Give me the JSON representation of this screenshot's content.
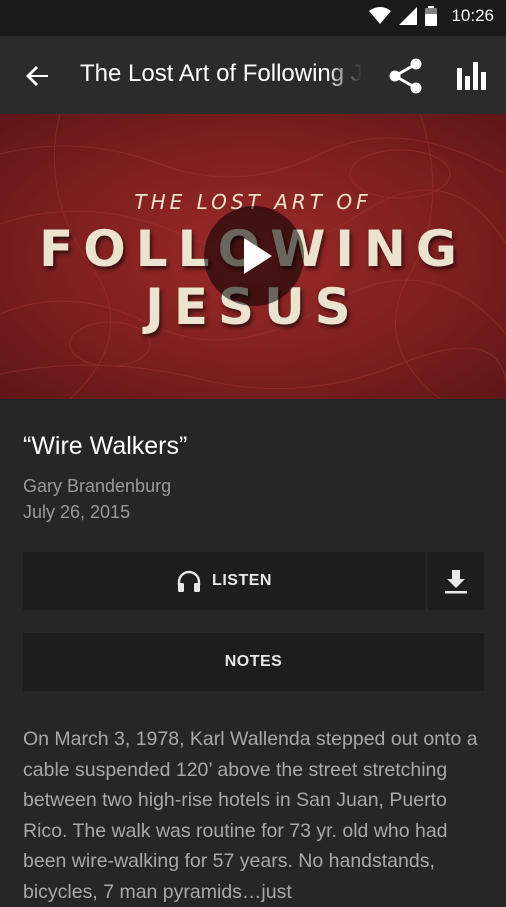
{
  "status_bar": {
    "time": "10:26",
    "icons": [
      "wifi-icon",
      "cell-signal-icon",
      "battery-icon"
    ]
  },
  "app_bar": {
    "title": "The Lost Art of Following Jesus",
    "back_icon": "arrow-left-icon",
    "share_icon": "share-icon",
    "stats_icon": "bar-chart-icon"
  },
  "hero": {
    "line1": "THE LOST ART OF",
    "line2": "FOLLOWING",
    "line3": "JESUS",
    "play_icon": "play-icon"
  },
  "sermon": {
    "title": "“Wire Walkers”",
    "speaker": "Gary Brandenburg",
    "date": "July 26, 2015"
  },
  "actions": {
    "listen_label": "LISTEN",
    "listen_icon": "headphones-icon",
    "download_icon": "download-icon",
    "notes_label": "NOTES"
  },
  "description": "On March 3, 1978, Karl Wallenda stepped out onto a cable suspended 120’ above the street stretching between two high-rise hotels in San Juan, Puerto Rico. The walk was routine for 73 yr. old who had been wire-walking for 57 years. No handstands, bicycles, 7 man pyramids…just",
  "colors": {
    "background": "#262626",
    "app_bar": "#2b2b2b",
    "status_bar": "#1a1a1a",
    "button": "#1d1d1d",
    "hero_red": "#8b2323",
    "hero_text": "#ece3cf",
    "secondary_text": "#9a9a9a"
  }
}
